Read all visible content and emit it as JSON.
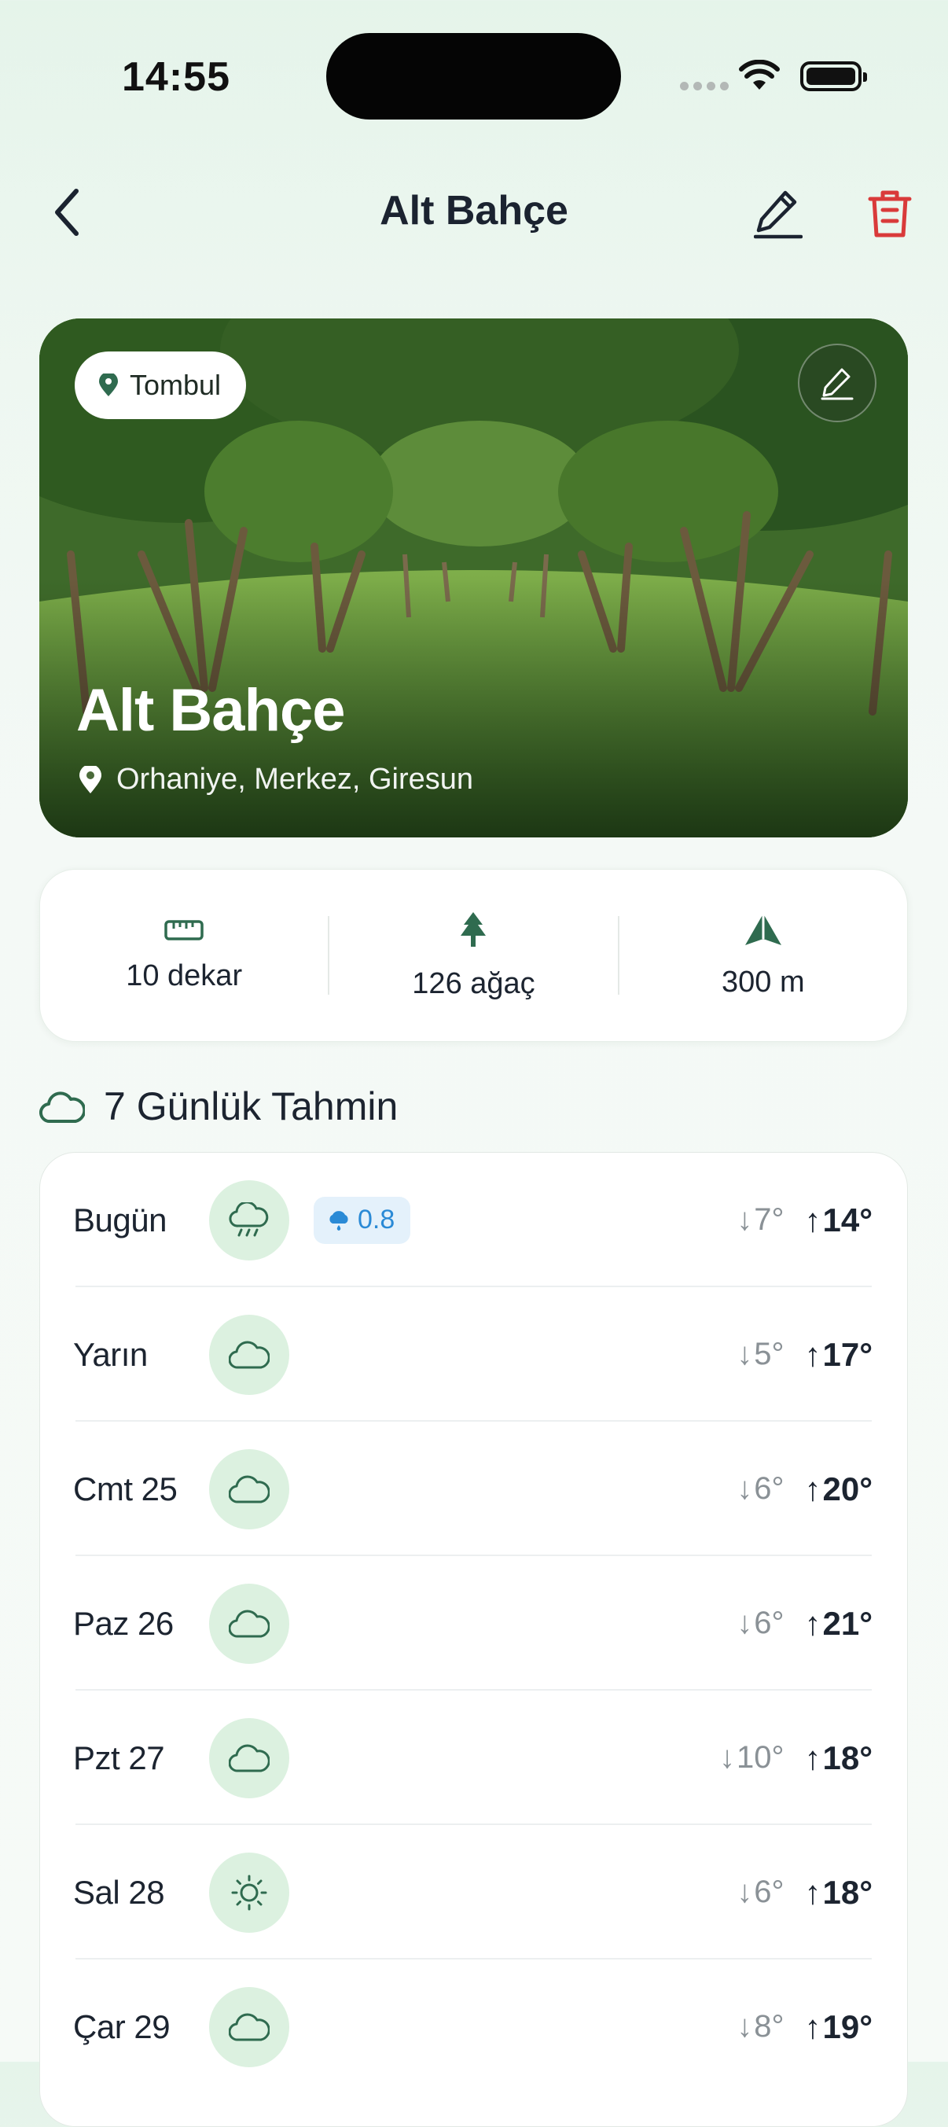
{
  "status_bar": {
    "time": "14:55"
  },
  "nav": {
    "title": "Alt Bahçe"
  },
  "hero": {
    "variety": "Tombul",
    "garden_name": "Alt Bahçe",
    "location": "Orhaniye, Merkez, Giresun"
  },
  "stats": {
    "area": "10 dekar",
    "trees": "126 ağaç",
    "altitude": "300 m"
  },
  "forecast": {
    "title": "7 Günlük Tahmin",
    "days": [
      {
        "day": "Bugün",
        "icon": "rain-cloud-icon",
        "rain": "0.8",
        "low": "7°",
        "high": "14°"
      },
      {
        "day": "Yarın",
        "icon": "cloudy-icon",
        "low": "5°",
        "high": "17°"
      },
      {
        "day": "Cmt 25",
        "icon": "cloudy-icon",
        "low": "6°",
        "high": "20°"
      },
      {
        "day": "Paz 26",
        "icon": "cloudy-icon",
        "low": "6°",
        "high": "21°"
      },
      {
        "day": "Pzt 27",
        "icon": "cloudy-icon",
        "low": "10°",
        "high": "18°"
      },
      {
        "day": "Sal 28",
        "icon": "sun-icon",
        "low": "6°",
        "high": "18°"
      },
      {
        "day": "Çar 29",
        "icon": "cloudy-icon",
        "low": "8°",
        "high": "19°"
      }
    ]
  },
  "colors": {
    "accent": "#2f6b4f",
    "danger": "#d93a3a",
    "rain_text": "#2a8ad6",
    "icon_bg": "#dcf1e0"
  }
}
